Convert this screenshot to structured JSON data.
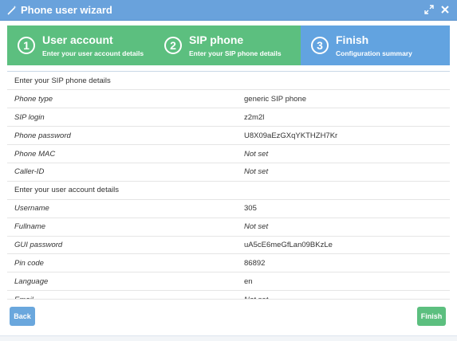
{
  "window": {
    "title": "Phone user wizard"
  },
  "steps": [
    {
      "number": "1",
      "title": "User account",
      "subtitle": "Enter your user account details"
    },
    {
      "number": "2",
      "title": "SIP phone",
      "subtitle": "Enter your SIP phone details"
    },
    {
      "number": "3",
      "title": "Finish",
      "subtitle": "Configuration summary"
    }
  ],
  "summary": {
    "sip_section": "Enter your SIP phone details",
    "sip_rows": [
      {
        "label": "Phone type",
        "value": "generic SIP phone",
        "not_set": false
      },
      {
        "label": "SIP login",
        "value": "z2m2l",
        "not_set": false
      },
      {
        "label": "Phone password",
        "value": "U8X09aEzGXqYKTHZH7Kr",
        "not_set": false
      },
      {
        "label": "Phone MAC",
        "value": "Not set",
        "not_set": true
      },
      {
        "label": "Caller-ID",
        "value": "Not set",
        "not_set": true
      }
    ],
    "account_section": "Enter your user account details",
    "account_rows": [
      {
        "label": "Username",
        "value": "305",
        "not_set": false
      },
      {
        "label": "Fullname",
        "value": "Not set",
        "not_set": true
      },
      {
        "label": "GUI password",
        "value": "uA5cE6meGfLan09BKzLe",
        "not_set": false
      },
      {
        "label": "Pin code",
        "value": "86892",
        "not_set": false
      },
      {
        "label": "Language",
        "value": "en",
        "not_set": false
      },
      {
        "label": "Email",
        "value": "Not set",
        "not_set": true
      }
    ]
  },
  "buttons": {
    "back": "Back",
    "finish": "Finish"
  },
  "colors": {
    "titlebar": "#69a2dc",
    "step_done": "#5cbf7f",
    "step_active": "#62a3e0"
  }
}
